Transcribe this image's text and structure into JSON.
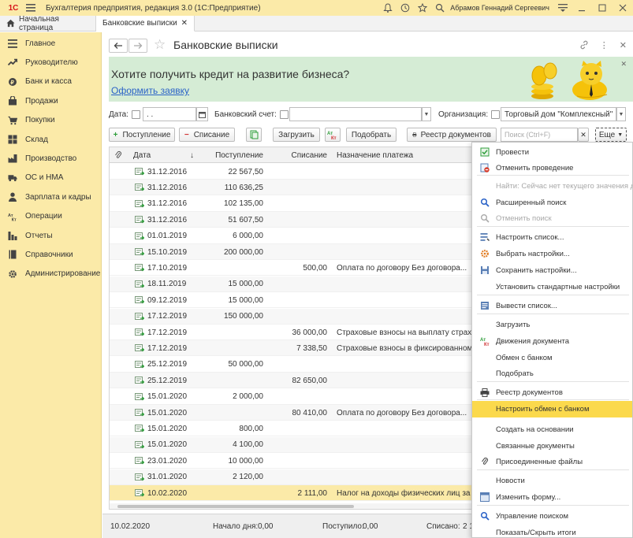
{
  "titlebar": {
    "logo": "1С",
    "title": "Бухгалтерия предприятия, редакция 3.0  (1С:Предприятие)",
    "user": "Абрамов Геннадий Сергеевич"
  },
  "tabs": {
    "home": "Начальная страница",
    "active": "Банковские выписки"
  },
  "sidebar": {
    "items": [
      {
        "label": "Главное",
        "icon": "menu-lines-icon"
      },
      {
        "label": "Руководителю",
        "icon": "trend-icon"
      },
      {
        "label": "Банк и касса",
        "icon": "coin-icon"
      },
      {
        "label": "Продажи",
        "icon": "bag-icon"
      },
      {
        "label": "Покупки",
        "icon": "cart-icon"
      },
      {
        "label": "Склад",
        "icon": "warehouse-icon"
      },
      {
        "label": "Производство",
        "icon": "factory-icon"
      },
      {
        "label": "ОС и НМА",
        "icon": "truck-icon"
      },
      {
        "label": "Зарплата и кадры",
        "icon": "person-icon"
      },
      {
        "label": "Операции",
        "icon": "operations-icon"
      },
      {
        "label": "Отчеты",
        "icon": "bar-chart-icon"
      },
      {
        "label": "Справочники",
        "icon": "book-icon"
      },
      {
        "label": "Администрирование",
        "icon": "gear-icon"
      }
    ]
  },
  "header": {
    "title": "Банковские выписки"
  },
  "banner": {
    "title": "Хотите получить кредит на развитие бизнеса?",
    "link": "Оформить заявку"
  },
  "filters": {
    "date_label": "Дата:",
    "date_value": ". .",
    "account_label": "Банковский счет:",
    "org_label": "Организация:",
    "org_value": "Торговый дом \"Комплексный\""
  },
  "toolbar": {
    "incoming": "Поступление",
    "outgoing": "Списание",
    "load": "Загрузить",
    "pick": "Подобрать",
    "registry": "Реестр документов",
    "search_placeholder": "Поиск (Ctrl+F)",
    "more": "Еще"
  },
  "table": {
    "headers": {
      "date": "Дата",
      "sort": "↓",
      "income": "Поступление",
      "expense": "Списание",
      "purpose": "Назначение платежа"
    },
    "rows": [
      {
        "date": "31.12.2016",
        "income": "22 567,50",
        "expense": "",
        "purpose": ""
      },
      {
        "date": "31.12.2016",
        "income": "110 636,25",
        "expense": "",
        "purpose": ""
      },
      {
        "date": "31.12.2016",
        "income": "102 135,00",
        "expense": "",
        "purpose": ""
      },
      {
        "date": "31.12.2016",
        "income": "51 607,50",
        "expense": "",
        "purpose": ""
      },
      {
        "date": "01.01.2019",
        "income": "6 000,00",
        "expense": "",
        "purpose": ""
      },
      {
        "date": "15.10.2019",
        "income": "200 000,00",
        "expense": "",
        "purpose": ""
      },
      {
        "date": "17.10.2019",
        "income": "",
        "expense": "500,00",
        "purpose": "Оплата по договору Без договора..."
      },
      {
        "date": "18.11.2019",
        "income": "15 000,00",
        "expense": "",
        "purpose": ""
      },
      {
        "date": "09.12.2019",
        "income": "15 000,00",
        "expense": "",
        "purpose": ""
      },
      {
        "date": "17.12.2019",
        "income": "150 000,00",
        "expense": "",
        "purpose": ""
      },
      {
        "date": "17.12.2019",
        "income": "",
        "expense": "36 000,00",
        "purpose": "Страховые взносы на выплату страховой"
      },
      {
        "date": "17.12.2019",
        "income": "",
        "expense": "7 338,50",
        "purpose": "Страховые взносы в фиксированном разм"
      },
      {
        "date": "25.12.2019",
        "income": "50 000,00",
        "expense": "",
        "purpose": ""
      },
      {
        "date": "25.12.2019",
        "income": "",
        "expense": "82 650,00",
        "purpose": ""
      },
      {
        "date": "15.01.2020",
        "income": "2 000,00",
        "expense": "",
        "purpose": ""
      },
      {
        "date": "15.01.2020",
        "income": "",
        "expense": "80 410,00",
        "purpose": "Оплата по договору Без договора..."
      },
      {
        "date": "15.01.2020",
        "income": "800,00",
        "expense": "",
        "purpose": ""
      },
      {
        "date": "15.01.2020",
        "income": "4 100,00",
        "expense": "",
        "purpose": ""
      },
      {
        "date": "23.01.2020",
        "income": "10 000,00",
        "expense": "",
        "purpose": ""
      },
      {
        "date": "31.01.2020",
        "income": "2 120,00",
        "expense": "",
        "purpose": ""
      },
      {
        "date": "10.02.2020",
        "income": "",
        "expense": "2 111,00",
        "purpose": "Налог на доходы физических лиц за янва"
      }
    ]
  },
  "footer": {
    "date": "10.02.2020",
    "start_label": "Начало дня:",
    "start_value": "0,00",
    "in_label": "Поступило:",
    "in_value": "0,00",
    "out_label": "Списано:",
    "out_value": "2 1"
  },
  "menu": {
    "items": [
      {
        "label": "Провести",
        "icon": "post-icon",
        "disabled": false
      },
      {
        "label": "Отменить проведение",
        "icon": "unpost-icon",
        "disabled": false
      },
      {
        "label": "Найти: Сейчас нет текущего значения для",
        "icon": "",
        "disabled": true
      },
      {
        "label": "Расширенный поиск",
        "icon": "advanced-search-icon",
        "disabled": false
      },
      {
        "label": "Отменить поиск",
        "icon": "cancel-search-icon",
        "disabled": true
      },
      {
        "label": "Настроить список...",
        "icon": "list-settings-icon",
        "disabled": false
      },
      {
        "label": "Выбрать настройки...",
        "icon": "choose-settings-icon",
        "disabled": false
      },
      {
        "label": "Сохранить настройки...",
        "icon": "save-settings-icon",
        "disabled": false
      },
      {
        "label": "Установить стандартные настройки",
        "icon": "",
        "disabled": false
      },
      {
        "label": "Вывести список...",
        "icon": "output-list-icon",
        "disabled": false
      },
      {
        "label": "Загрузить",
        "icon": "",
        "disabled": false
      },
      {
        "label": "Движения документа",
        "icon": "dt-kt-icon",
        "disabled": false
      },
      {
        "label": "Обмен с банком",
        "icon": "",
        "disabled": false
      },
      {
        "label": "Подобрать",
        "icon": "",
        "disabled": false
      },
      {
        "label": "Реестр документов",
        "icon": "printer-icon",
        "disabled": false
      },
      {
        "label": "Настроить обмен с банком",
        "icon": "",
        "disabled": false
      },
      {
        "label": "Создать на основании",
        "icon": "",
        "disabled": false
      },
      {
        "label": "Связанные документы",
        "icon": "",
        "disabled": false
      },
      {
        "label": "Присоединенные файлы",
        "icon": "paperclip-icon",
        "disabled": false
      },
      {
        "label": "Новости",
        "icon": "",
        "disabled": false
      },
      {
        "label": "Изменить форму...",
        "icon": "form-icon",
        "disabled": false
      },
      {
        "label": "Управление поиском",
        "icon": "search-icon",
        "disabled": false
      },
      {
        "label": "Показать/Скрыть итоги",
        "icon": "",
        "disabled": false
      }
    ],
    "highlighted_index": 15
  },
  "colors": {
    "brand": "#fbeaa8",
    "highlight": "#fbd94c",
    "banner": "#d5ecd5",
    "link": "#2a62c7"
  }
}
